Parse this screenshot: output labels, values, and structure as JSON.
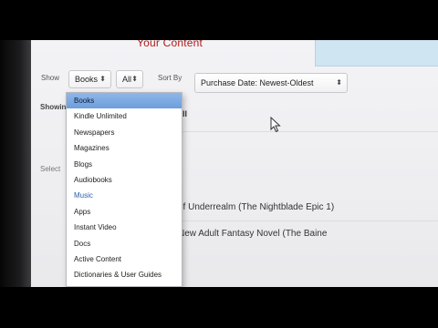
{
  "page": {
    "heading_fragment": "Your Content",
    "showing_label": "Showing",
    "select_hint": "Select",
    "results_tick": "ll"
  },
  "toolbar": {
    "show_label": "Show",
    "category_value": "Books",
    "subcategory_value": "All",
    "sort_label": "Sort By",
    "sort_value": "Purchase Date: Newest-Oldest"
  },
  "dropdown": {
    "items": [
      {
        "label": "Books"
      },
      {
        "label": "Kindle Unlimited"
      },
      {
        "label": "Newspapers"
      },
      {
        "label": "Magazines"
      },
      {
        "label": "Blogs"
      },
      {
        "label": "Audiobooks"
      },
      {
        "label": "Music"
      },
      {
        "label": "Apps"
      },
      {
        "label": "Instant Video"
      },
      {
        "label": "Docs"
      },
      {
        "label": "Active Content"
      },
      {
        "label": "Dictionaries & User Guides"
      }
    ],
    "selected_index": 0,
    "hovered_index": 6
  },
  "results": [
    {
      "title": "of Underrealm (The Nightblade Epic 1)"
    },
    {
      "title": "New Adult Fantasy Novel (The Baine"
    }
  ],
  "icons": {
    "chevron": "chevron-updown-icon",
    "cursor": "mouse-pointer-icon"
  }
}
